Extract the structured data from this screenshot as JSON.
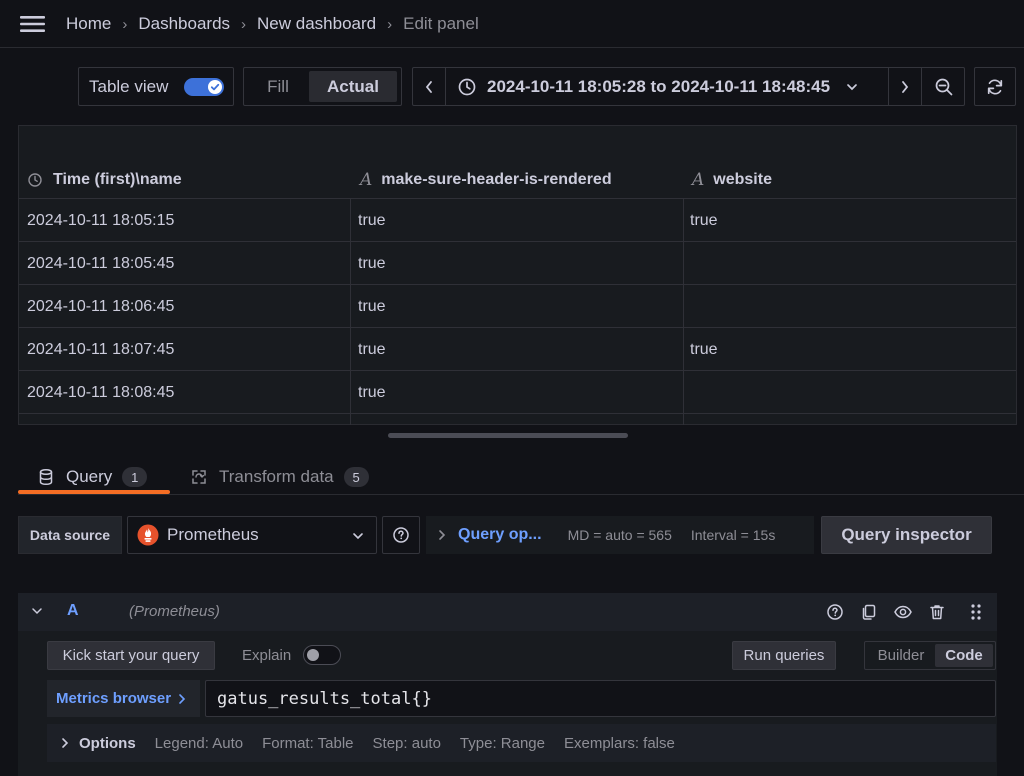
{
  "breadcrumbs": [
    "Home",
    "Dashboards",
    "New dashboard",
    "Edit panel"
  ],
  "toolbar": {
    "table_view_label": "Table view",
    "table_view_on": true,
    "fill_label": "Fill",
    "actual_label": "Actual",
    "time_range": "2024-10-11 18:05:28 to 2024-10-11 18:48:45"
  },
  "table": {
    "columns": [
      "Time (first)\\name",
      "make-sure-header-is-rendered",
      "website"
    ],
    "rows": [
      [
        "2024-10-11 18:05:15",
        "true",
        "true"
      ],
      [
        "2024-10-11 18:05:45",
        "true",
        ""
      ],
      [
        "2024-10-11 18:06:45",
        "true",
        ""
      ],
      [
        "2024-10-11 18:07:45",
        "true",
        "true"
      ],
      [
        "2024-10-11 18:08:45",
        "true",
        ""
      ]
    ]
  },
  "tabs": [
    {
      "label": "Query",
      "count": "1",
      "active": true
    },
    {
      "label": "Transform data",
      "count": "5",
      "active": false
    }
  ],
  "datasource": {
    "label": "Data source",
    "selected": "Prometheus"
  },
  "query_options": {
    "title": "Query op...",
    "md": "MD = auto = 565",
    "interval": "Interval = 15s"
  },
  "inspector_label": "Query inspector",
  "query": {
    "ref_id": "A",
    "datasource_hint": "(Prometheus)",
    "kick_start_label": "Kick start your query",
    "explain_label": "Explain",
    "explain_on": false,
    "run_label": "Run queries",
    "modes": [
      "Builder",
      "Code"
    ],
    "active_mode": "Code",
    "metrics_browser_label": "Metrics browser",
    "expr": "gatus_results_total{}",
    "options": {
      "label": "Options",
      "items": [
        "Legend: Auto",
        "Format: Table",
        "Step: auto",
        "Type: Range",
        "Exemplars: false"
      ]
    }
  },
  "colors": {
    "accent_blue": "#3d71d9",
    "link_blue": "#6e9fff",
    "tab_underline": "#f46d24",
    "prometheus_orange": "#e6522c"
  }
}
